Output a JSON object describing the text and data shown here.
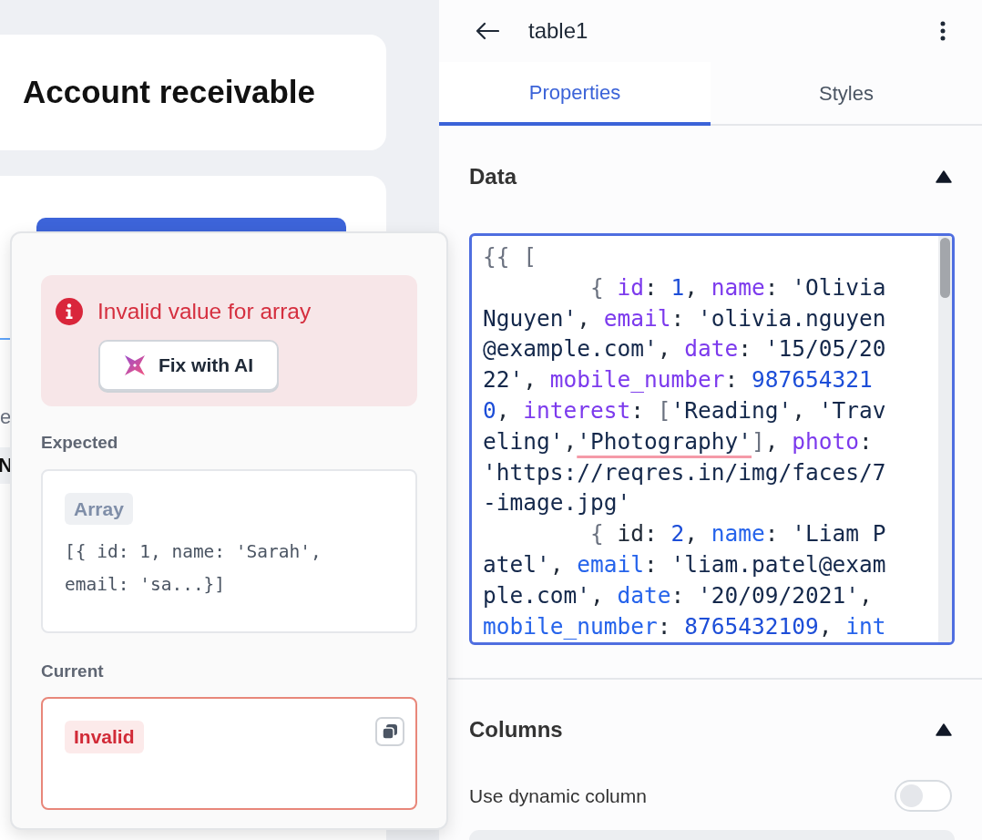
{
  "canvas": {
    "card_title": "Account receivable",
    "fragments": [
      "e",
      "N"
    ]
  },
  "panel": {
    "title": "table1",
    "tabs": [
      {
        "label": "Properties",
        "selected": true
      },
      {
        "label": "Styles",
        "selected": false
      }
    ],
    "sections": [
      {
        "title": "Data",
        "expanded": true
      },
      {
        "title": "Columns",
        "expanded": true
      }
    ],
    "code_lines": [
      {
        "indented": false,
        "tokens": [
          {
            "t": "{{ [",
            "kind": "punct"
          }
        ]
      },
      {
        "indented": true,
        "tokens": [
          {
            "t": "{ ",
            "kind": "punct"
          },
          {
            "t": "id",
            "kind": "key"
          },
          {
            "t": ": ",
            "kind": "plain"
          },
          {
            "t": "1",
            "kind": "num"
          },
          {
            "t": ", ",
            "kind": "plain"
          },
          {
            "t": "name",
            "kind": "key"
          },
          {
            "t": ": ",
            "kind": "plain"
          },
          {
            "t": "'Olivia",
            "kind": "str"
          }
        ]
      },
      {
        "indented": false,
        "tokens": [
          {
            "t": "Nguyen'",
            "kind": "str"
          },
          {
            "t": ", ",
            "kind": "plain"
          },
          {
            "t": "email",
            "kind": "key"
          },
          {
            "t": ": ",
            "kind": "plain"
          },
          {
            "t": "'olivia.nguyen",
            "kind": "str"
          }
        ]
      },
      {
        "indented": false,
        "tokens": [
          {
            "t": "@example.com'",
            "kind": "str"
          },
          {
            "t": ", ",
            "kind": "plain"
          },
          {
            "t": "date",
            "kind": "key"
          },
          {
            "t": ": ",
            "kind": "plain"
          },
          {
            "t": "'15/05/20",
            "kind": "str"
          }
        ]
      },
      {
        "indented": false,
        "tokens": [
          {
            "t": "22'",
            "kind": "str"
          },
          {
            "t": ", ",
            "kind": "plain"
          },
          {
            "t": "mobile_number",
            "kind": "key"
          },
          {
            "t": ": ",
            "kind": "plain"
          },
          {
            "t": "987654321",
            "kind": "num"
          }
        ]
      },
      {
        "indented": false,
        "tokens": [
          {
            "t": "0",
            "kind": "num"
          },
          {
            "t": ", ",
            "kind": "plain"
          },
          {
            "t": "interest",
            "kind": "key"
          },
          {
            "t": ": ",
            "kind": "plain"
          },
          {
            "t": "[",
            "kind": "punct"
          },
          {
            "t": "'Reading'",
            "kind": "str"
          },
          {
            "t": ", ",
            "kind": "plain"
          },
          {
            "t": "'Trav",
            "kind": "str"
          }
        ]
      },
      {
        "indented": false,
        "tokens": [
          {
            "t": "eling'",
            "kind": "str"
          },
          {
            "t": ",",
            "kind": "plain"
          },
          {
            "t": "'Photography'",
            "kind": "error"
          },
          {
            "t": "]",
            "kind": "punct"
          },
          {
            "t": ", ",
            "kind": "plain"
          },
          {
            "t": "photo",
            "kind": "key"
          },
          {
            "t": ":",
            "kind": "plain"
          }
        ]
      },
      {
        "indented": false,
        "tokens": [
          {
            "t": "'https://reqres.in/img/faces/7",
            "kind": "str"
          }
        ]
      },
      {
        "indented": false,
        "tokens": [
          {
            "t": "-image.jpg'",
            "kind": "str"
          }
        ]
      },
      {
        "indented": true,
        "tokens": [
          {
            "t": "{ ",
            "kind": "punct"
          },
          {
            "t": "id",
            "kind": "plain"
          },
          {
            "t": ": ",
            "kind": "plain"
          },
          {
            "t": "2",
            "kind": "num"
          },
          {
            "t": ", ",
            "kind": "plain"
          },
          {
            "t": "name",
            "kind": "key2"
          },
          {
            "t": ": ",
            "kind": "plain"
          },
          {
            "t": "'Liam P",
            "kind": "str"
          }
        ]
      },
      {
        "indented": false,
        "tokens": [
          {
            "t": "atel'",
            "kind": "str"
          },
          {
            "t": ", ",
            "kind": "plain"
          },
          {
            "t": "email",
            "kind": "key2"
          },
          {
            "t": ": ",
            "kind": "plain"
          },
          {
            "t": "'liam.patel@exam",
            "kind": "str"
          }
        ]
      },
      {
        "indented": false,
        "tokens": [
          {
            "t": "ple.com'",
            "kind": "str"
          },
          {
            "t": ", ",
            "kind": "plain"
          },
          {
            "t": "date",
            "kind": "key2"
          },
          {
            "t": ": ",
            "kind": "plain"
          },
          {
            "t": "'20/09/2021'",
            "kind": "str"
          },
          {
            "t": ",",
            "kind": "plain"
          }
        ]
      },
      {
        "indented": false,
        "tokens": [
          {
            "t": "mobile_number",
            "kind": "key2"
          },
          {
            "t": ": ",
            "kind": "plain"
          },
          {
            "t": "8765432109",
            "kind": "num"
          },
          {
            "t": ", ",
            "kind": "plain"
          },
          {
            "t": "int",
            "kind": "key2"
          }
        ]
      }
    ],
    "toggle": {
      "label": "Use dynamic column",
      "on": false
    }
  },
  "popover": {
    "error": "Invalid value for array",
    "fix_button": "Fix with AI",
    "expected_label": "Expected",
    "expected_type": "Array",
    "expected_value": "[{ id: 1, name: 'Sarah', email: 'sa...}]",
    "current_label": "Current",
    "current_value": "Invalid"
  }
}
